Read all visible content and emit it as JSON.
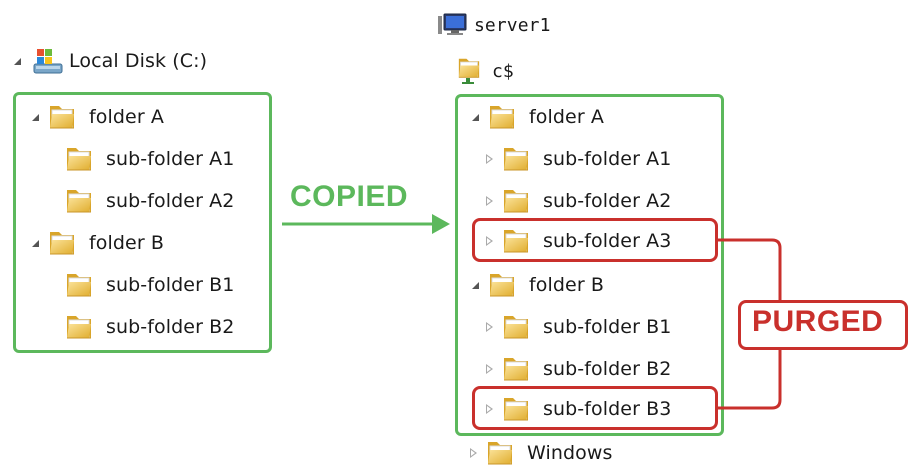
{
  "left_tree": {
    "root_label": "Local Disk (C:)",
    "items": [
      {
        "label": "folder A",
        "level": 1
      },
      {
        "label": "sub-folder A1",
        "level": 2
      },
      {
        "label": "sub-folder A2",
        "level": 2
      },
      {
        "label": "folder B",
        "level": 1
      },
      {
        "label": "sub-folder B1",
        "level": 2
      },
      {
        "label": "sub-folder B2",
        "level": 2
      }
    ]
  },
  "right_tree": {
    "server_label": "server1",
    "share_label": "c$",
    "items": [
      {
        "label": "folder A",
        "level": 1
      },
      {
        "label": "sub-folder A1",
        "level": 2
      },
      {
        "label": "sub-folder A2",
        "level": 2
      },
      {
        "label": "sub-folder A3",
        "level": 2,
        "purged": true
      },
      {
        "label": "folder B",
        "level": 1
      },
      {
        "label": "sub-folder B1",
        "level": 2
      },
      {
        "label": "sub-folder B2",
        "level": 2
      },
      {
        "label": "sub-folder B3",
        "level": 2,
        "purged": true
      },
      {
        "label": "Windows",
        "level": 1
      }
    ]
  },
  "annotations": {
    "copied": "COPIED",
    "purged": "PURGED"
  },
  "colors": {
    "copied_green": "#5cb85c",
    "purged_red": "#c9302c",
    "folder_yellow": "#f0c84a"
  }
}
